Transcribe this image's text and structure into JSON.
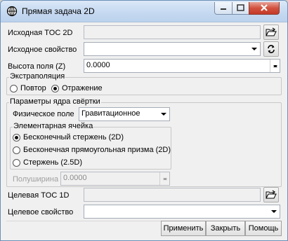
{
  "window": {
    "title": "Прямая задача 2D",
    "icon": "globe-icon"
  },
  "source_toc": {
    "label": "Исходная TOC 2D",
    "value": "",
    "browse_icon": "open-folder-icon"
  },
  "source_property": {
    "label": "Исходное свойство",
    "value": "",
    "refresh_icon": "refresh-icon"
  },
  "field_height": {
    "label": "Высота поля (Z)",
    "value": "0.0000"
  },
  "extrapolation": {
    "title": "Экстраполяция",
    "options": [
      {
        "label": "Повтор",
        "checked": false
      },
      {
        "label": "Отражение",
        "checked": true
      }
    ]
  },
  "kernel": {
    "title": "Параметры ядра свёртки",
    "physical_field_label": "Физическое поле",
    "physical_field_value": "Гравитационное",
    "element": {
      "title": "Элементарная ячейка",
      "options": [
        {
          "label": "Бесконечный стержень (2D)",
          "checked": true
        },
        {
          "label": "Бесконечная прямоугольная призма (2D)",
          "checked": false
        },
        {
          "label": "Стержень (2.5D)",
          "checked": false
        }
      ]
    },
    "half_width_label": "Полуширина",
    "half_width_value": "0.0000"
  },
  "target_toc": {
    "label": "Целевая TOC 1D",
    "value": "",
    "browse_icon": "open-folder-icon"
  },
  "target_property": {
    "label": "Целевое свойство",
    "value": ""
  },
  "buttons": {
    "apply": "Применить",
    "close": "Закрыть",
    "help": "Помощь"
  }
}
